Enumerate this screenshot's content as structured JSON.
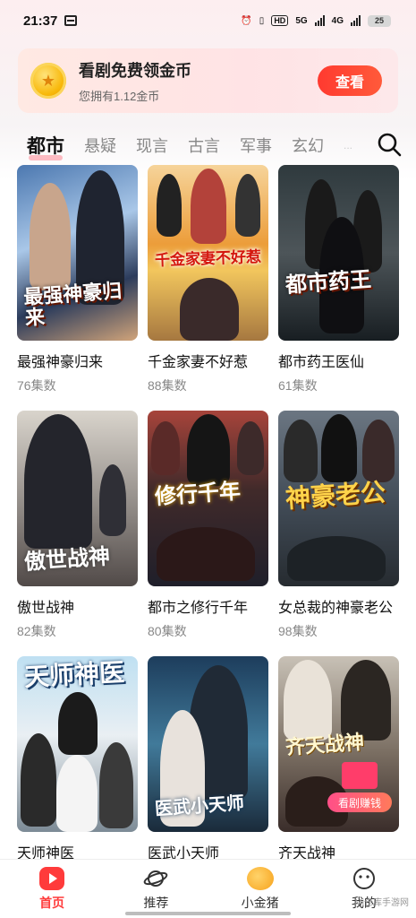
{
  "status_bar": {
    "time": "21:37",
    "network_hd": "HD",
    "network_5g": "5G",
    "network_4g": "4G",
    "battery": "25"
  },
  "coin_banner": {
    "title": "看剧免费领金币",
    "subtitle": "您拥有1.12金币",
    "button_label": "查看",
    "coin_icon": "coin-icon"
  },
  "tabs": [
    {
      "label": "都市",
      "active": true
    },
    {
      "label": "悬疑"
    },
    {
      "label": "现言"
    },
    {
      "label": "古言"
    },
    {
      "label": "军事"
    },
    {
      "label": "玄幻"
    },
    {
      "label": "..."
    }
  ],
  "search": {
    "icon": "search-icon"
  },
  "dramas": [
    {
      "title": "最强神豪归来",
      "count": "76集数",
      "poster_text": "最强神豪归来"
    },
    {
      "title": "千金家妻不好惹",
      "count": "88集数",
      "poster_text": "千金家妻不好惹"
    },
    {
      "title": "都市药王医仙",
      "count": "61集数",
      "poster_text": "都市药王"
    },
    {
      "title": "傲世战神",
      "count": "82集数",
      "poster_text": "傲世战神"
    },
    {
      "title": "都市之修行千年",
      "count": "80集数",
      "poster_text": "修行千年"
    },
    {
      "title": "女总裁的神豪老公",
      "count": "98集数",
      "poster_text": "神豪老公"
    },
    {
      "title": "天师神医",
      "count": "",
      "poster_text": "天师神医"
    },
    {
      "title": "医武小天师",
      "count": "",
      "poster_text": "医武小天师"
    },
    {
      "title": "齐天战神",
      "count": "",
      "poster_text": "齐天战神",
      "badge": "看剧赚钱"
    }
  ],
  "bottom_nav": [
    {
      "label": "首页",
      "icon": "home-icon",
      "active": true
    },
    {
      "label": "推荐",
      "icon": "planet-icon"
    },
    {
      "label": "小金猪",
      "icon": "pig-icon"
    },
    {
      "label": "我的",
      "icon": "profile-icon"
    }
  ],
  "watermark": "Mi仓库手游网",
  "colors": {
    "accent": "#ff3b3b",
    "banner_bg": "#ffe6e6",
    "tab_underline": "#ff4a5a"
  }
}
